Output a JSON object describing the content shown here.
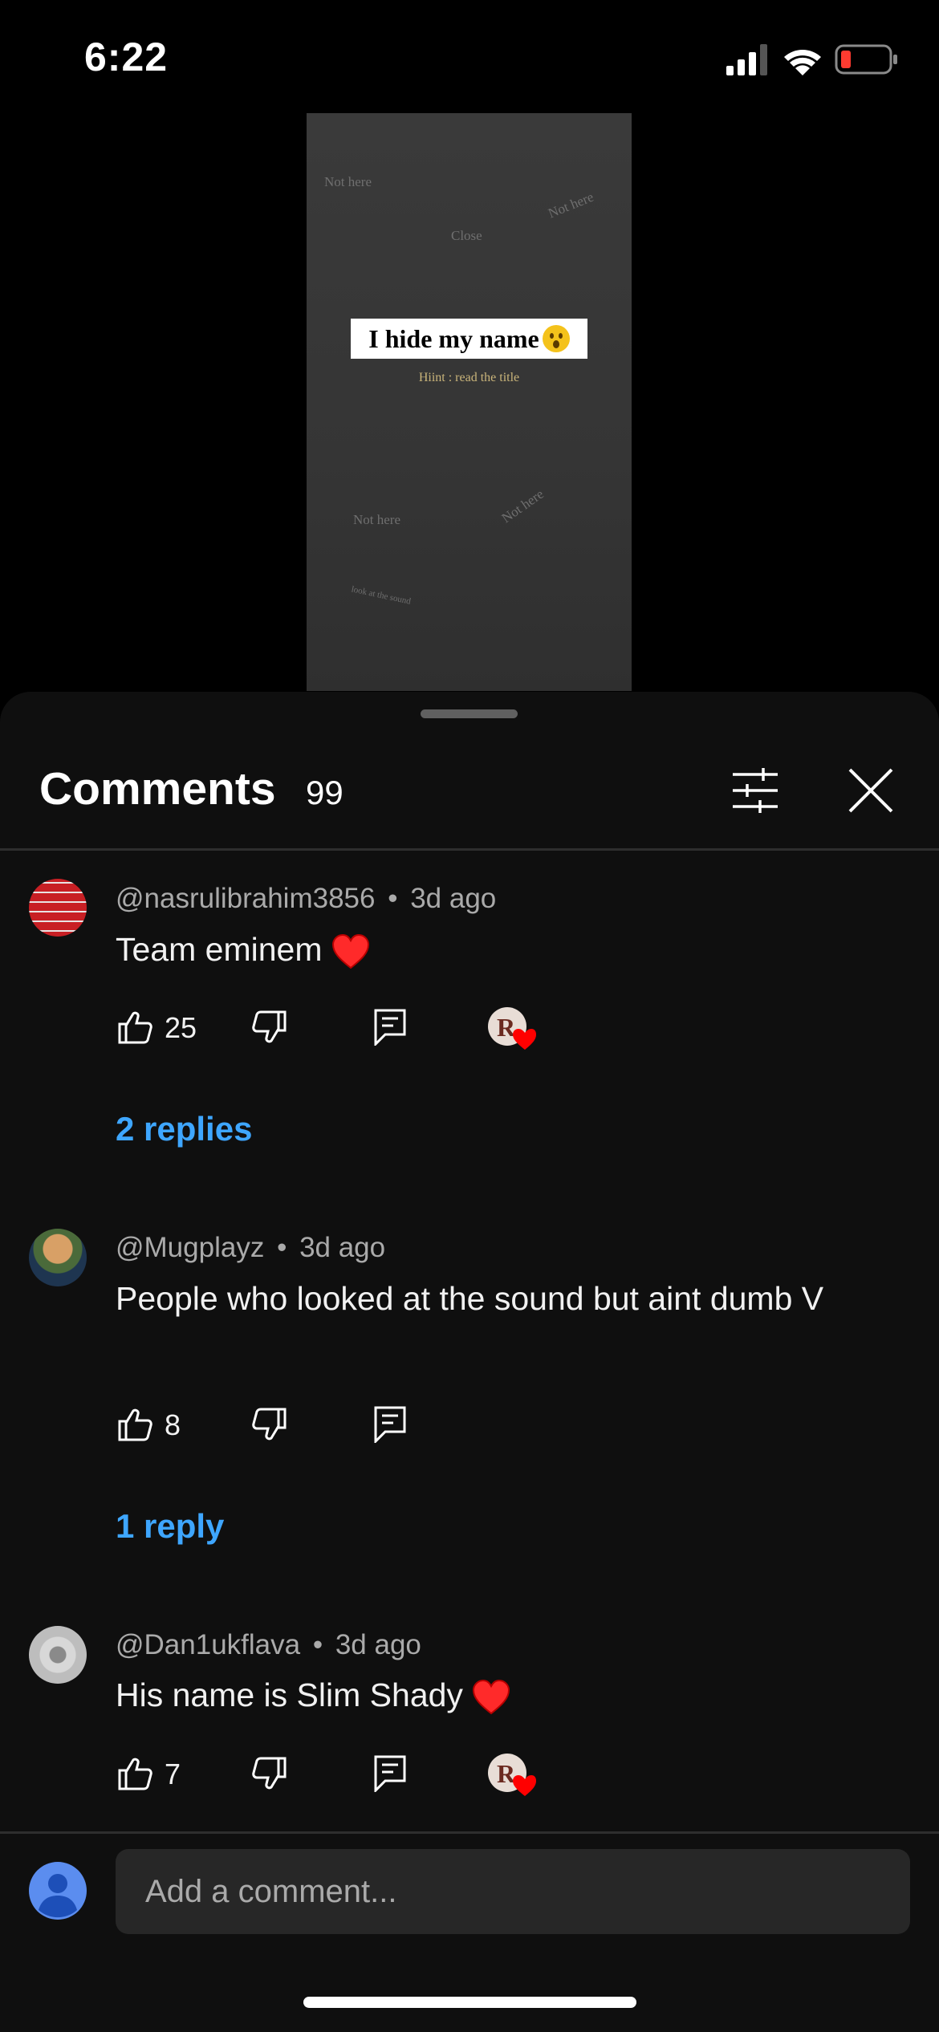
{
  "status_bar": {
    "time": "6:22"
  },
  "video": {
    "title": "I hide my name",
    "hint": "Hiint : read the title",
    "faint_texts": [
      "Not here",
      "Close",
      "Not here",
      "Not here",
      "Not here",
      "look at the sound"
    ]
  },
  "sheet": {
    "title": "Comments",
    "count": "99"
  },
  "comments": [
    {
      "author": "@nasrulibrahim3856",
      "age": "3d ago",
      "text": "Team eminem",
      "likes": "25",
      "creator_liked": true,
      "replies": "2 replies"
    },
    {
      "author": "@Mugplayz",
      "age": "3d ago",
      "text": "People who looked at the sound but aint dumb V",
      "likes": "8",
      "creator_liked": false,
      "replies": "1 reply"
    },
    {
      "author": "@Dan1ukflava",
      "age": "3d ago",
      "text": "His name is Slim Shady",
      "likes": "7",
      "creator_liked": true,
      "replies": ""
    }
  ],
  "meta_separator": "•",
  "input": {
    "placeholder": "Add a comment..."
  },
  "colors": {
    "reply_link": "#3ea6ff",
    "heart": "#ff0000",
    "sheet_bg": "#0f0f0f",
    "input_bg": "#272727"
  },
  "icons": [
    "signal-icon",
    "wifi-icon",
    "battery-icon",
    "filter-icon",
    "close-icon",
    "like-icon",
    "dislike-icon",
    "reply-icon",
    "creator-heart-icon",
    "user-avatar-icon"
  ]
}
